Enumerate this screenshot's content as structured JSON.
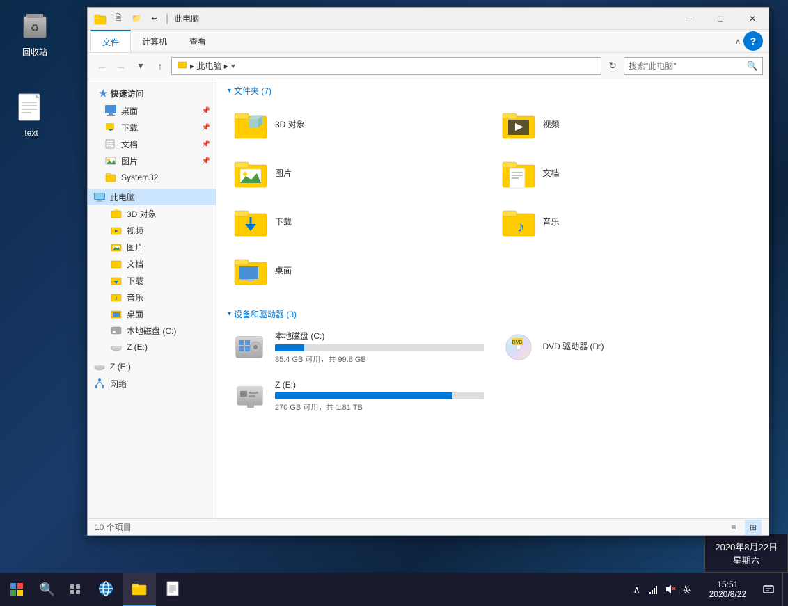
{
  "desktop": {
    "icons": [
      {
        "id": "recycle-bin",
        "label": "回收站",
        "emoji": "🗑️"
      },
      {
        "id": "text-file",
        "label": "text",
        "emoji": "📄"
      }
    ]
  },
  "taskbar": {
    "start_label": "开始",
    "apps": [
      {
        "id": "ie",
        "label": "Internet Explorer"
      },
      {
        "id": "file-explorer",
        "label": "文件资源管理器",
        "active": true
      },
      {
        "id": "notepad",
        "label": "记事本"
      }
    ],
    "tray": {
      "lang": "英",
      "time": "15:51",
      "date": "2020/8/22"
    },
    "clock_line1": "15:51",
    "clock_line2": "2020/8/22"
  },
  "explorer": {
    "title": "此电脑",
    "breadcrumb": "此电脑",
    "tabs": [
      {
        "id": "file",
        "label": "文件",
        "active": true
      },
      {
        "id": "computer",
        "label": "计算机"
      },
      {
        "id": "view",
        "label": "查看"
      }
    ],
    "search_placeholder": "搜索\"此电脑\"",
    "sidebar": {
      "quick_access": "快速访问",
      "items_quick": [
        {
          "label": "桌面",
          "pin": true
        },
        {
          "label": "下载",
          "pin": true
        },
        {
          "label": "文档",
          "pin": true
        },
        {
          "label": "图片",
          "pin": true
        },
        {
          "label": "System32",
          "pin": false
        }
      ],
      "this_pc": "此电脑",
      "items_pc": [
        {
          "label": "3D 对象"
        },
        {
          "label": "视频"
        },
        {
          "label": "图片"
        },
        {
          "label": "文档"
        },
        {
          "label": "下载"
        },
        {
          "label": "音乐"
        },
        {
          "label": "桌面"
        },
        {
          "label": "本地磁盘 (C:)"
        },
        {
          "label": "Z (E:)"
        }
      ],
      "z_e_standalone": "Z (E:)",
      "network": "网络"
    },
    "folders_section": "文件夹 (7)",
    "folders": [
      {
        "label": "3D 对象",
        "icon": "3d"
      },
      {
        "label": "视频",
        "icon": "video"
      },
      {
        "label": "图片",
        "icon": "pics"
      },
      {
        "label": "文档",
        "icon": "docs"
      },
      {
        "label": "下载",
        "icon": "download"
      },
      {
        "label": "音乐",
        "icon": "music"
      },
      {
        "label": "桌面",
        "icon": "desktop"
      }
    ],
    "drives_section": "设备和驱动器 (3)",
    "drives": [
      {
        "label": "本地磁盘 (C:)",
        "size_info": "85.4 GB 可用，共 99.6 GB",
        "used_pct": 14,
        "icon": "hdd"
      },
      {
        "label": "DVD 驱动器 (D:)",
        "size_info": "",
        "used_pct": 0,
        "icon": "dvd"
      },
      {
        "label": "Z (E:)",
        "size_info": "270 GB 可用，共 1.81 TB",
        "used_pct": 85,
        "icon": "usb"
      }
    ],
    "status_count": "10 个项目",
    "view_mode": "details"
  }
}
